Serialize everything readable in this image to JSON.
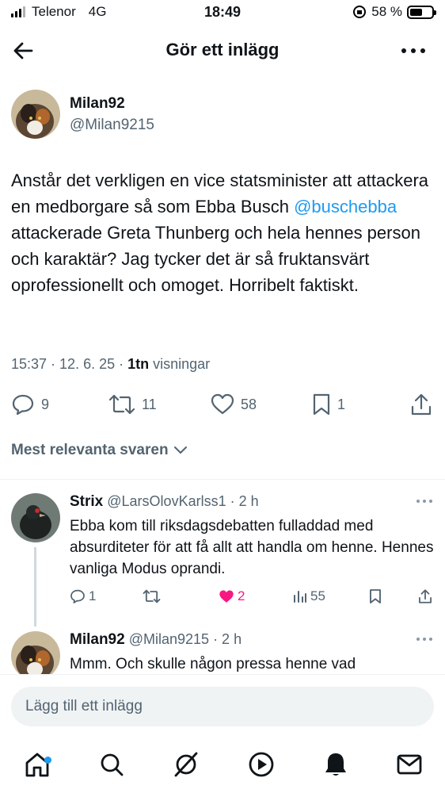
{
  "status_bar": {
    "carrier": "Telenor",
    "network": "4G",
    "time": "18:49",
    "battery_percent": "58 %",
    "battery_level": 0.58
  },
  "header": {
    "title": "Gör ett inlägg",
    "back_icon": "arrow-left-icon",
    "more_icon": "more-horizontal-icon"
  },
  "post": {
    "author_name": "Milan92",
    "author_handle": "@Milan9215",
    "text_before_mention": "Anstår det verkligen en vice statsminister att attackera en medborgare så som Ebba Busch ",
    "mention": "@buschebba",
    "text_after_mention": " attackerade Greta Thunberg och hela hennes person och karaktär? Jag tycker det är så fruktansvärt oprofessionellt och omoget. Horribelt faktiskt.",
    "time": "15:37",
    "sep1": " · ",
    "date": "12. 6. 25",
    "sep2": " · ",
    "views_count": "1tn",
    "views_label": " visningar",
    "replies": "9",
    "reposts": "11",
    "likes": "58",
    "bookmarks": "1"
  },
  "sort": {
    "label": "Mest relevanta svaren"
  },
  "replies": [
    {
      "name": "Strix",
      "handle": "@LarsOlovKarlss1",
      "age": " · 2 h",
      "text": "Ebba kom till riksdagsdebatten fulladdad med absurditeter för att få allt att handla om henne. Hennes vanliga Modus oprandi.",
      "replies": "1",
      "reposts": "",
      "likes": "2",
      "views": "55",
      "liked_color": "#f91880"
    },
    {
      "name": "Milan92",
      "handle": "@Milan9215",
      "age": " · 2 h",
      "text": "Mmm. Och skulle någon pressa henne vad"
    }
  ],
  "composer": {
    "placeholder": "Lägg till ett inlägg"
  },
  "tabbar": {
    "items": [
      "home-icon",
      "search-icon",
      "grok-icon",
      "video-icon",
      "notifications-icon",
      "messages-icon"
    ]
  },
  "colors": {
    "accent": "#1d9bf0",
    "muted": "#536471",
    "like": "#f91880"
  }
}
